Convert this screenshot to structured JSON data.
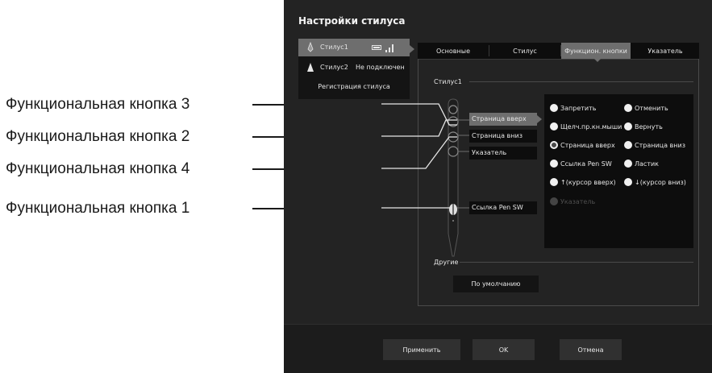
{
  "callouts": [
    "Функциональная кнопка 3",
    "Функциональная кнопка 2",
    "Функциональная кнопка 4",
    "Функциональная кнопка 1"
  ],
  "dialog": {
    "title": "Настройки стилуса",
    "styluses": [
      {
        "name": "Стилус1",
        "state": "",
        "selected": true
      },
      {
        "name": "Стилус2",
        "state": "Не подключен",
        "selected": false
      }
    ],
    "register_label": "Регистрация стилуса",
    "tabs": [
      {
        "label": "Основные",
        "active": false
      },
      {
        "label": "Стилус",
        "active": false
      },
      {
        "label": "Функцион. кнопки",
        "active": true
      },
      {
        "label": "Указатель",
        "active": false
      }
    ],
    "section_stylus": "Стилус1",
    "section_other": "Другие",
    "pen_buttons": [
      {
        "label": "Страница вверх",
        "selected": true
      },
      {
        "label": "Страница вниз",
        "selected": false
      },
      {
        "label": "Указатель",
        "selected": false
      },
      {
        "label": "Ссылка Pen SW",
        "selected": false
      }
    ],
    "options": [
      {
        "label": "Запретить",
        "checked": false,
        "disabled": false
      },
      {
        "label": "Отменить",
        "checked": false,
        "disabled": false
      },
      {
        "label": "Щелч.пр.кн.мыши",
        "checked": false,
        "disabled": false
      },
      {
        "label": "Вернуть",
        "checked": false,
        "disabled": false
      },
      {
        "label": "Страница вверх",
        "checked": true,
        "disabled": false
      },
      {
        "label": "Страница вниз",
        "checked": false,
        "disabled": false
      },
      {
        "label": "Ссылка Pen SW",
        "checked": false,
        "disabled": false
      },
      {
        "label": "Ластик",
        "checked": false,
        "disabled": false
      },
      {
        "label": "↑(курсор вверх)",
        "checked": false,
        "disabled": false
      },
      {
        "label": "↓(курсор вниз)",
        "checked": false,
        "disabled": false
      },
      {
        "label": "Указатель",
        "checked": false,
        "disabled": true
      }
    ],
    "default_button": "По умолчанию",
    "apply_button": "Применить",
    "ok_button": "OK",
    "cancel_button": "Отмена",
    "colors": {
      "background": "#232323",
      "selected": "#6e6e6e",
      "dark": "#0d0d0d"
    },
    "icons": [
      "stylus-icon",
      "battery-icon",
      "signal-icon",
      "radio-icon"
    ]
  }
}
